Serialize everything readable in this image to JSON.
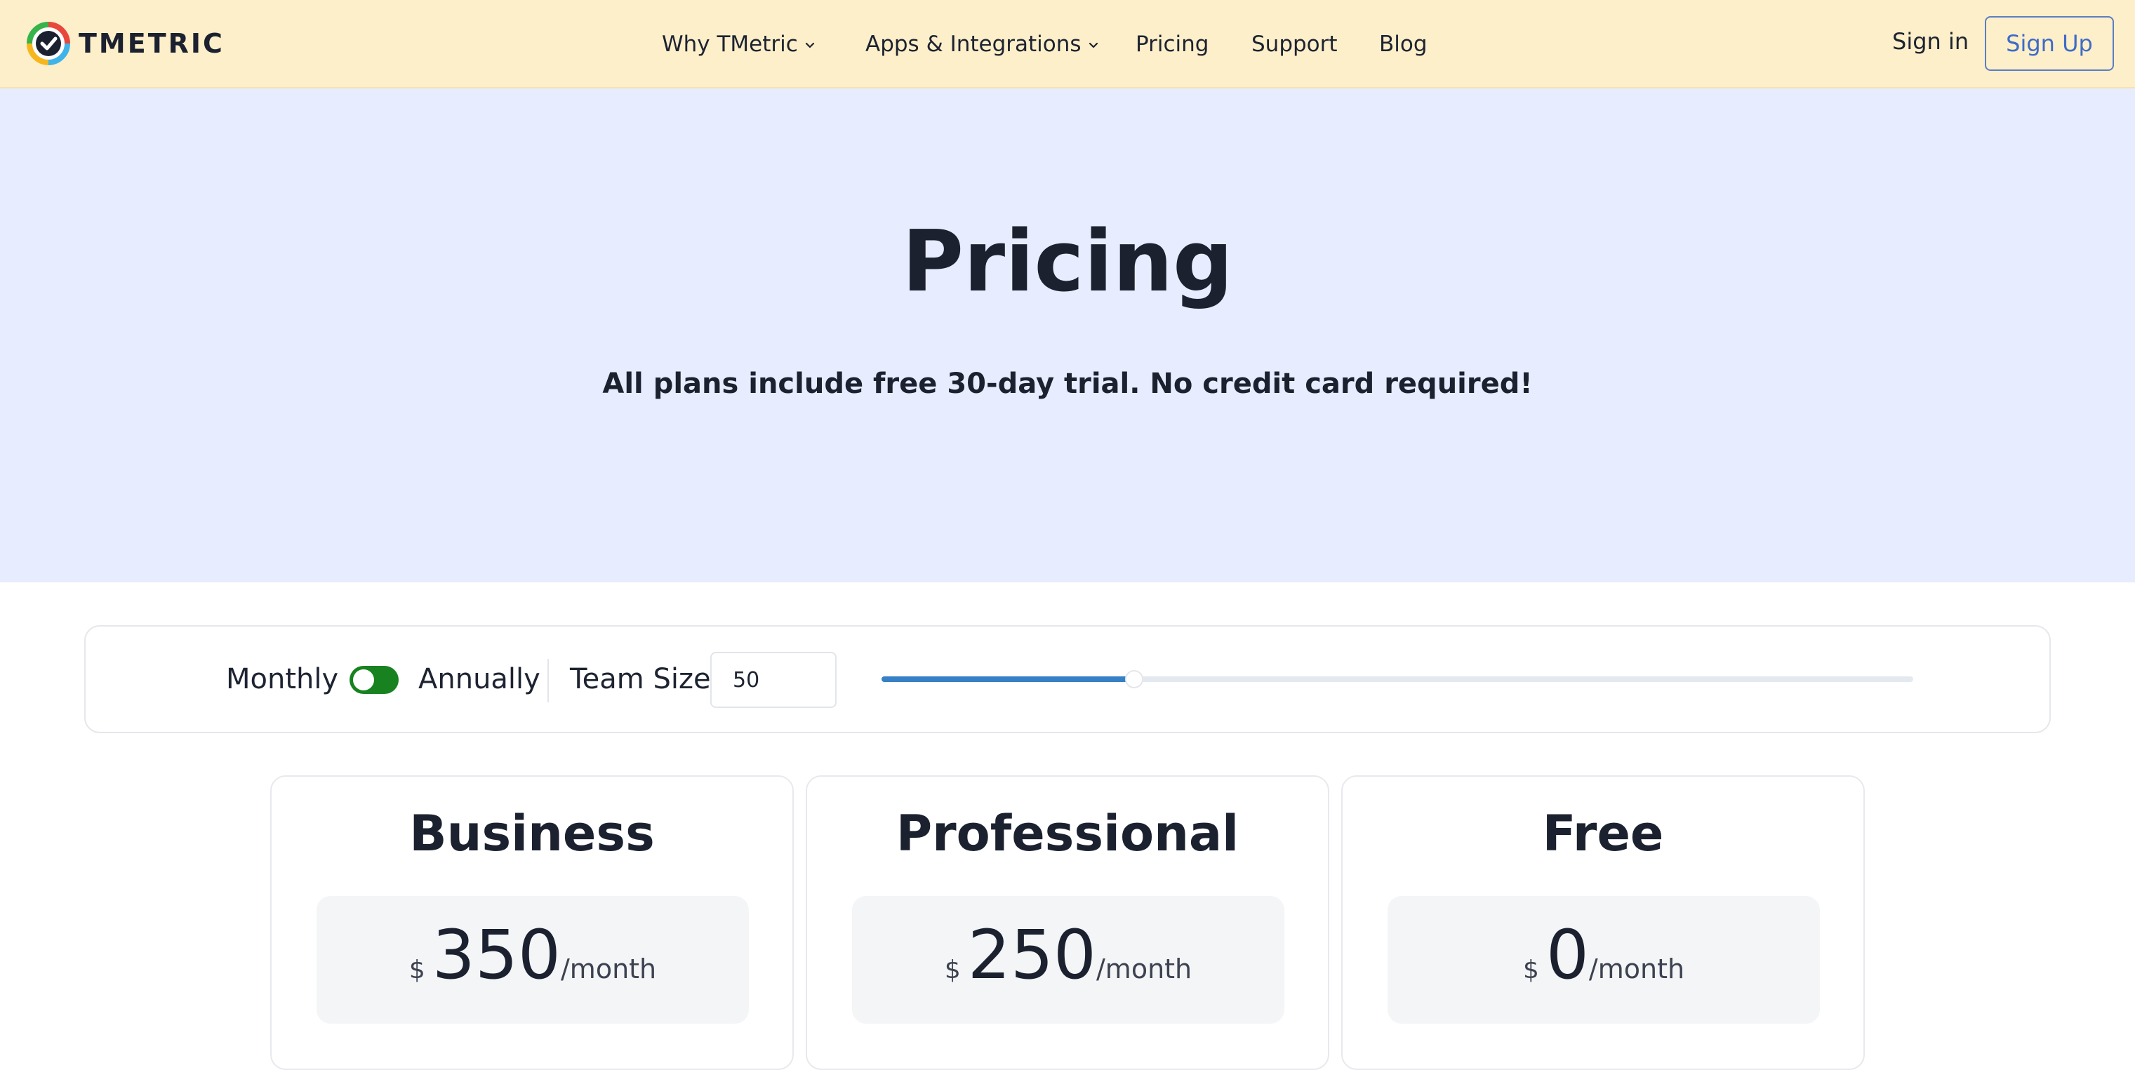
{
  "header": {
    "logo_text": "TMETRIC",
    "nav": [
      {
        "label": "Why TMetric",
        "has_dropdown": true
      },
      {
        "label": "Apps & Integrations",
        "has_dropdown": true
      },
      {
        "label": "Pricing",
        "has_dropdown": false
      },
      {
        "label": "Support",
        "has_dropdown": false
      },
      {
        "label": "Blog",
        "has_dropdown": false
      }
    ],
    "signin_label": "Sign in",
    "signup_label": "Sign Up"
  },
  "hero": {
    "title": "Pricing",
    "subtitle": "All plans include free 30-day trial. No credit card required!"
  },
  "controls": {
    "monthly_label": "Monthly",
    "annually_label": "Annually",
    "billing_toggle_on": true,
    "team_size_label": "Team Size",
    "team_size_value": "50",
    "slider_fraction": 0.245
  },
  "plans": [
    {
      "name": "Business",
      "currency": "$",
      "amount": "350",
      "period": "/month"
    },
    {
      "name": "Professional",
      "currency": "$",
      "amount": "250",
      "period": "/month"
    },
    {
      "name": "Free",
      "currency": "$",
      "amount": "0",
      "period": "/month"
    }
  ],
  "colors": {
    "header_bg": "#fcefc9",
    "hero_bg": "#e7ecfe",
    "toggle_on": "#17821f",
    "slider_accent": "#3680c5",
    "signup_accent": "#3d6bc8"
  },
  "icons": {
    "logo": "tmetric-logo-icon",
    "dropdown": "chevron-down-icon"
  }
}
